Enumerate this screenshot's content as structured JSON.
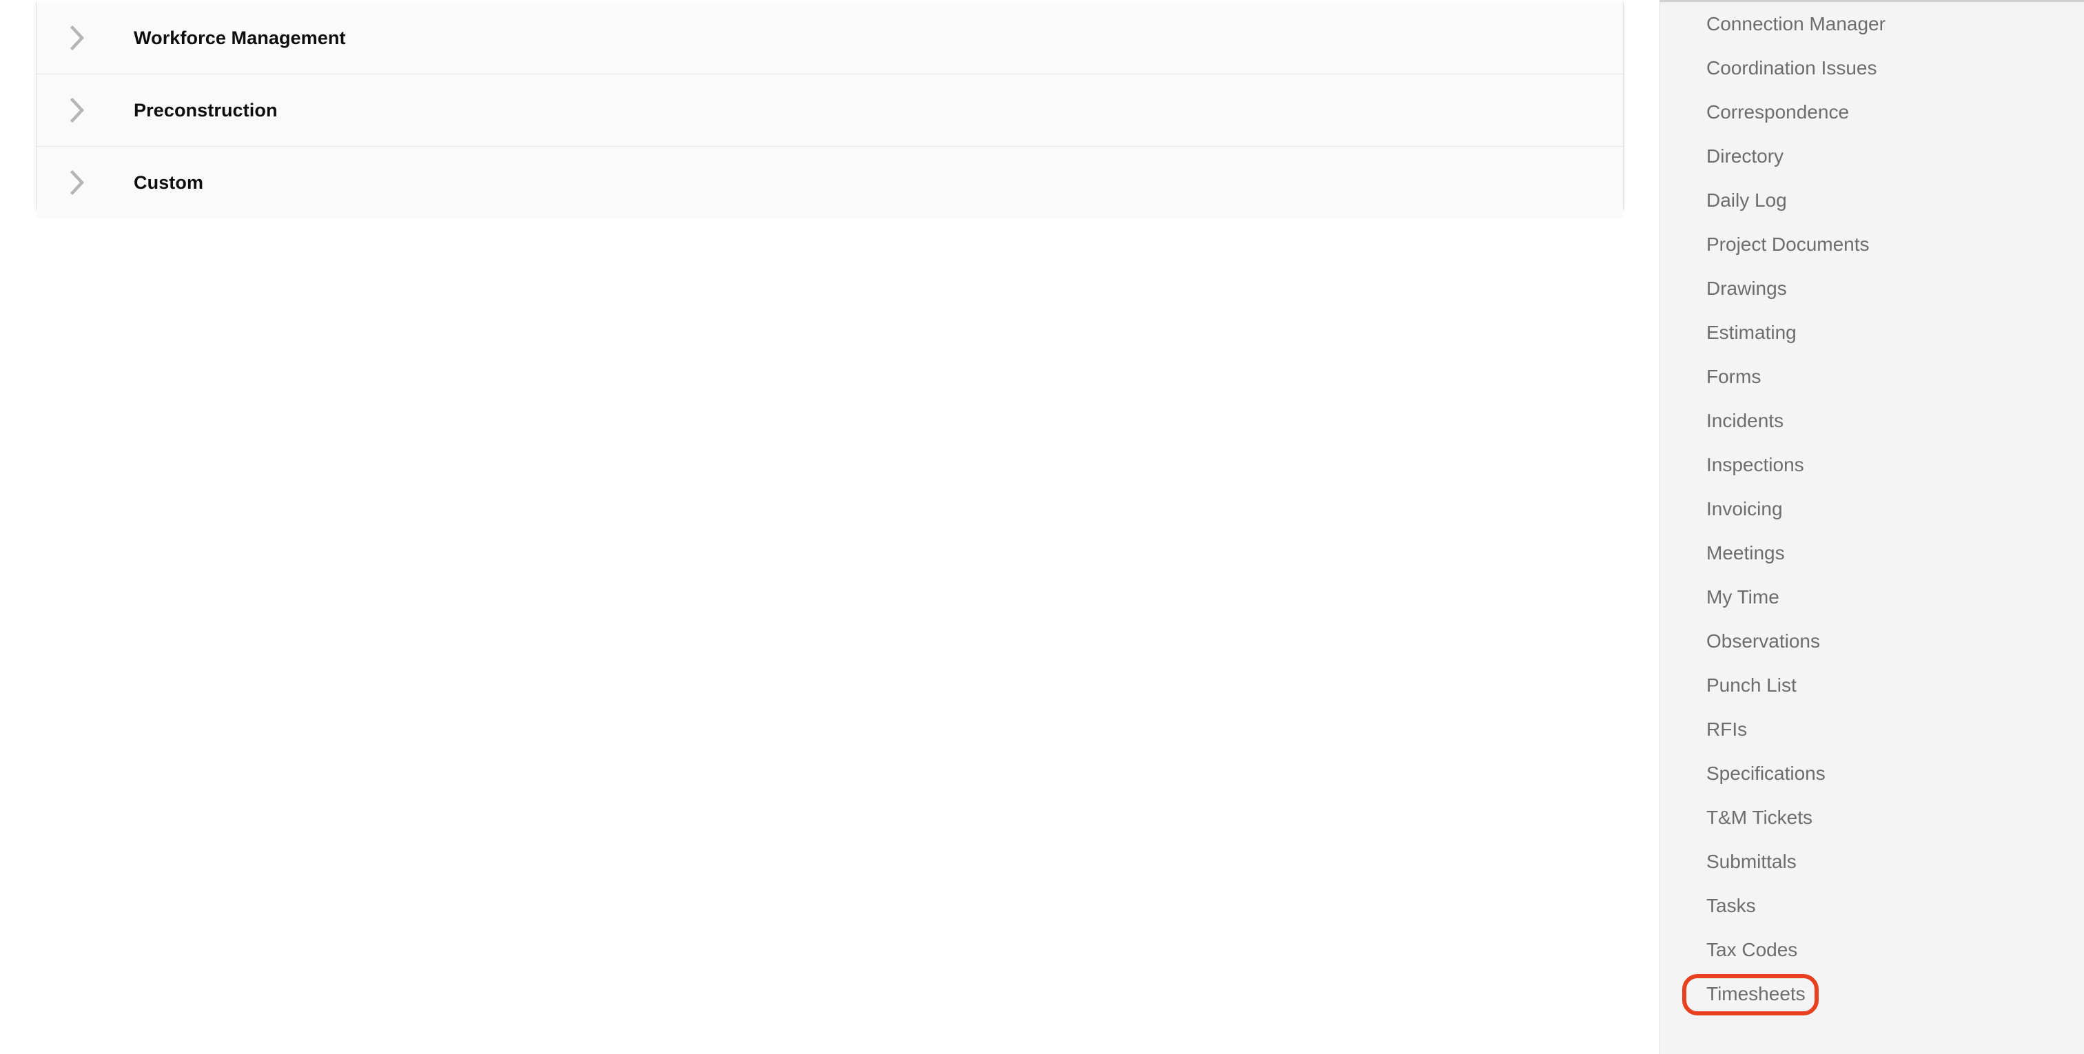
{
  "accent_colors": {
    "annotation_ring": "#e8401f",
    "card_background": "#fafafa",
    "card_border": "#dedede",
    "sidebar_background": "#f4f4f4",
    "sidebar_border": "#dcdcdc",
    "accordion_label_color": "#0d0d0d",
    "sidebar_label_color": "#6d6d6d",
    "chevron_color": "#b5b5b5"
  },
  "main": {
    "accordion": {
      "sections": [
        {
          "label": "Workforce Management",
          "expanded": false,
          "icon": "chevron-right-icon"
        },
        {
          "label": "Preconstruction",
          "expanded": false,
          "icon": "chevron-right-icon"
        },
        {
          "label": "Custom",
          "expanded": false,
          "icon": "chevron-right-icon"
        }
      ]
    }
  },
  "sidebar": {
    "items": [
      {
        "label": "Connection Manager",
        "annotated": false
      },
      {
        "label": "Coordination Issues",
        "annotated": false
      },
      {
        "label": "Correspondence",
        "annotated": false
      },
      {
        "label": "Directory",
        "annotated": false
      },
      {
        "label": "Daily Log",
        "annotated": false
      },
      {
        "label": "Project Documents",
        "annotated": false
      },
      {
        "label": "Drawings",
        "annotated": false
      },
      {
        "label": "Estimating",
        "annotated": false
      },
      {
        "label": "Forms",
        "annotated": false
      },
      {
        "label": "Incidents",
        "annotated": false
      },
      {
        "label": "Inspections",
        "annotated": false
      },
      {
        "label": "Invoicing",
        "annotated": false
      },
      {
        "label": "Meetings",
        "annotated": false
      },
      {
        "label": "My Time",
        "annotated": false
      },
      {
        "label": "Observations",
        "annotated": false
      },
      {
        "label": "Punch List",
        "annotated": false
      },
      {
        "label": "RFIs",
        "annotated": false
      },
      {
        "label": "Specifications",
        "annotated": false
      },
      {
        "label": "T&M Tickets",
        "annotated": false
      },
      {
        "label": "Submittals",
        "annotated": false
      },
      {
        "label": "Tasks",
        "annotated": false
      },
      {
        "label": "Tax Codes",
        "annotated": false
      },
      {
        "label": "Timesheets",
        "annotated": true
      }
    ]
  }
}
